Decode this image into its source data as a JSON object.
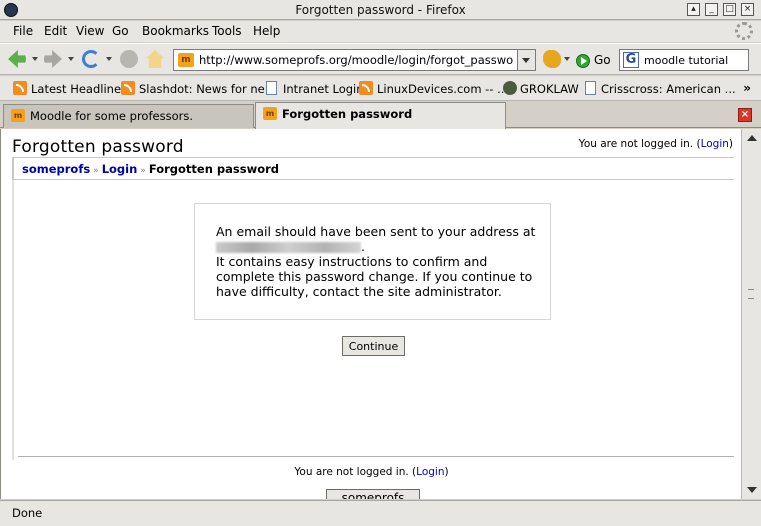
{
  "window": {
    "title": "Forgotten password - Firefox"
  },
  "menu": [
    {
      "label": "File"
    },
    {
      "label": "Edit"
    },
    {
      "label": "View"
    },
    {
      "label": "Go"
    },
    {
      "label": "Bookmarks"
    },
    {
      "label": "Tools"
    },
    {
      "label": "Help"
    }
  ],
  "navbar": {
    "url": "http://www.someprofs.org/moodle/login/forgot_password.php",
    "go_label": "Go",
    "search_value": "moodle tutorial",
    "search_engine_glyph": "G",
    "favicon_glyph": "m"
  },
  "bookmarks": [
    {
      "label": "Latest Headlines",
      "icon": "rss-icon"
    },
    {
      "label": "Slashdot: News for ne...",
      "icon": "rss-icon"
    },
    {
      "label": "Intranet Login",
      "icon": "page-icon"
    },
    {
      "label": "LinuxDevices.com -- ...",
      "icon": "rss-icon"
    },
    {
      "label": "GROKLAW",
      "icon": "groklaw-icon"
    },
    {
      "label": "Crisscross: American ...",
      "icon": "page-icon"
    }
  ],
  "bookmarks_overflow": "»",
  "tabs": [
    {
      "label": "Moodle for some professors.",
      "active": false
    },
    {
      "label": "Forgotten password",
      "active": true
    }
  ],
  "page": {
    "title": "Forgotten password",
    "login_status_prefix": "You are not logged in. (",
    "login_link": "Login",
    "login_status_suffix": ")",
    "breadcrumb": {
      "home": "someprofs",
      "login": "Login",
      "current": "Forgotten password",
      "separator": "»"
    },
    "message": {
      "line1": "An email should have been sent to your address at",
      "redacted_suffix": ".",
      "line2": "It contains easy instructions to confirm and complete this password change. If you continue to have difficulty, contact the site administrator."
    },
    "continue_label": "Continue",
    "footer_home_label": "someprofs"
  },
  "status": {
    "text": "Done"
  },
  "colors": {
    "link": "#0000cc",
    "breadcrumb": "#0000aa",
    "close_tab": "#d8372a"
  }
}
